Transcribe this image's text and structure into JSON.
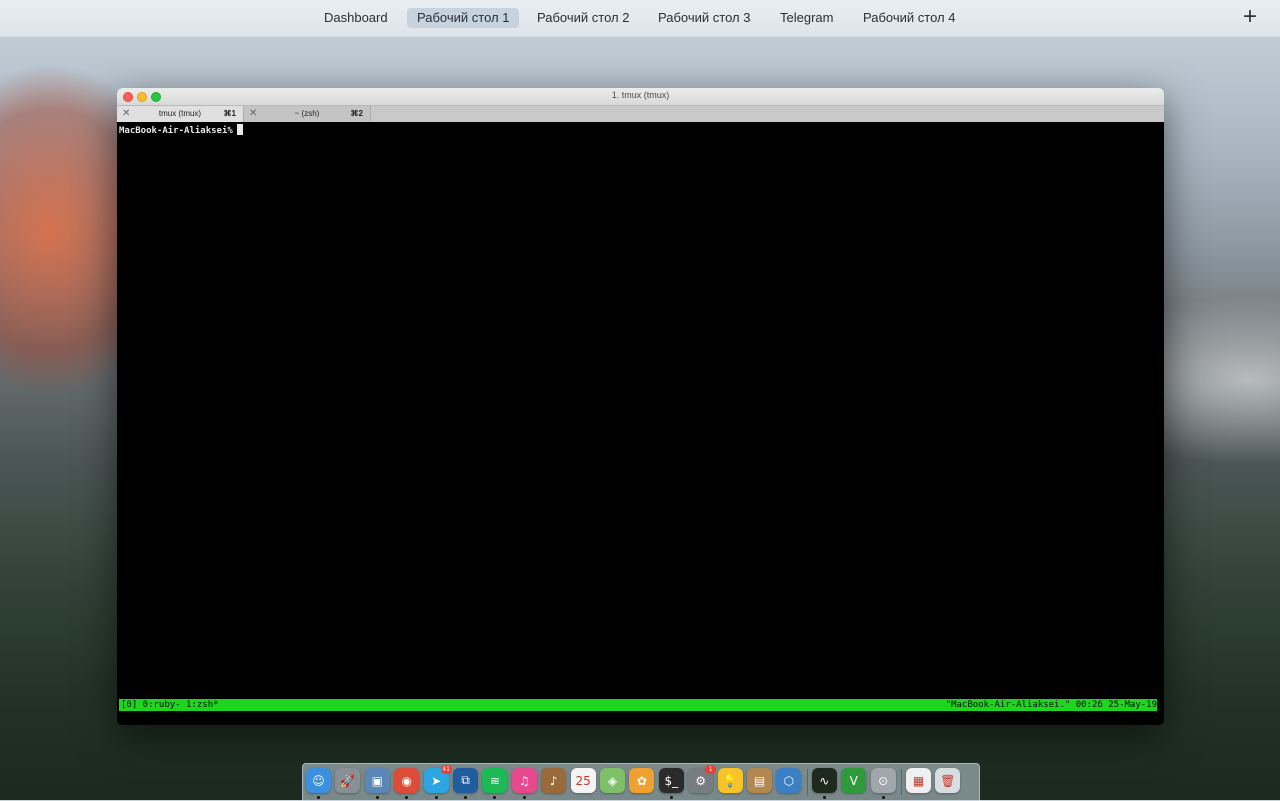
{
  "spaces": {
    "items": [
      {
        "label": "Dashboard",
        "active": false
      },
      {
        "label": "Рабочий стол 1",
        "active": true
      },
      {
        "label": "Рабочий стол 2",
        "active": false
      },
      {
        "label": "Рабочий стол 3",
        "active": false
      },
      {
        "label": "Telegram",
        "active": false
      },
      {
        "label": "Рабочий стол 4",
        "active": false
      }
    ],
    "add_label": "+"
  },
  "window": {
    "title": "1. tmux (tmux)",
    "tabs": [
      {
        "close": "✕",
        "label": "tmux (tmux)",
        "shortcut": "⌘1",
        "active": true
      },
      {
        "close": "✕",
        "label": "~ (zsh)",
        "shortcut": "⌘2",
        "active": false
      }
    ]
  },
  "terminal": {
    "prompt": "MacBook-Air-Aliaksei%",
    "status_left": "[0] 0:ruby- 1:zsh*",
    "status_right": "\"MacBook-Air-Aliaksei.\" 00:26 25-May-19",
    "status_color": "#1ed61e"
  },
  "dock": {
    "apps": [
      {
        "icon": "finder-icon",
        "glyph": "☺",
        "color": "#3d8fe0",
        "running": true
      },
      {
        "icon": "launchpad-icon",
        "glyph": "🚀",
        "color": "#8a8f96",
        "running": false
      },
      {
        "icon": "preview-icon",
        "glyph": "▣",
        "color": "#5a87b8",
        "running": true
      },
      {
        "icon": "chrome-icon",
        "glyph": "◉",
        "color": "#dd4b39",
        "running": true
      },
      {
        "icon": "telegram-icon",
        "glyph": "➤",
        "color": "#2ca5e0",
        "running": true,
        "badge": "41"
      },
      {
        "icon": "vscode-icon",
        "glyph": "⧉",
        "color": "#1f5d9e",
        "running": true
      },
      {
        "icon": "spotify-icon",
        "glyph": "≋",
        "color": "#1db954",
        "running": true
      },
      {
        "icon": "itunes-icon",
        "glyph": "♫",
        "color": "#e64a8c",
        "running": true
      },
      {
        "icon": "guitar-icon",
        "glyph": "♪",
        "color": "#9a6a3a",
        "running": false
      },
      {
        "icon": "calendar-icon",
        "glyph": "25",
        "color": "#f4f4f4",
        "running": false
      },
      {
        "icon": "maps-icon",
        "glyph": "◈",
        "color": "#7fbf6a",
        "running": false
      },
      {
        "icon": "photos-icon",
        "glyph": "✿",
        "color": "#f0a030",
        "running": false
      },
      {
        "icon": "terminal-icon",
        "glyph": "$_",
        "color": "#2b2b2b",
        "running": true
      },
      {
        "icon": "system-preferences-icon",
        "glyph": "⚙",
        "color": "#777c82",
        "running": false,
        "badge": "1"
      },
      {
        "icon": "lightbulb-icon",
        "glyph": "💡",
        "color": "#f6c42a",
        "running": false
      },
      {
        "icon": "archive-icon",
        "glyph": "▤",
        "color": "#b08850",
        "running": false
      },
      {
        "icon": "virtualbox-icon",
        "glyph": "⬡",
        "color": "#3b7fc4",
        "running": false
      },
      {
        "icon": "activity-monitor-icon",
        "glyph": "∿",
        "color": "#1e2a1e",
        "running": true
      },
      {
        "icon": "vim-icon",
        "glyph": "V",
        "color": "#2e9a3c",
        "running": false
      },
      {
        "icon": "disk-utility-icon",
        "glyph": "⊙",
        "color": "#a0a6ac",
        "running": true
      }
    ],
    "docs": [
      {
        "icon": "document-icon",
        "glyph": "▦",
        "color": "#f0f0f0",
        "running": false
      },
      {
        "icon": "trash-icon",
        "glyph": "🗑",
        "color": "#d8dde2",
        "running": false
      }
    ]
  }
}
